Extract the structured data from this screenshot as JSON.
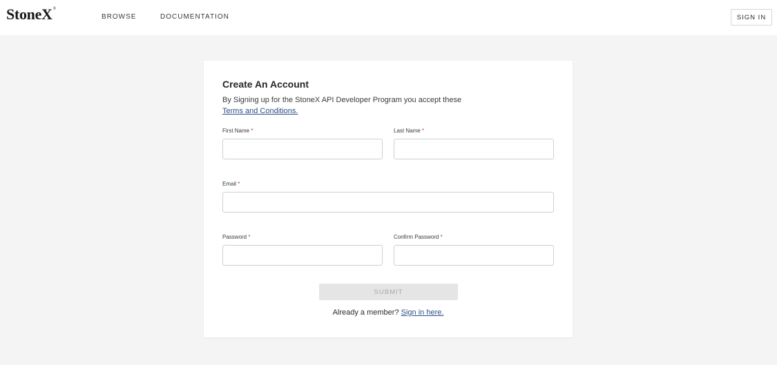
{
  "header": {
    "logo_text": "StoneX",
    "logo_mark": "®",
    "nav": [
      {
        "label": "BROWSE"
      },
      {
        "label": "DOCUMENTATION"
      }
    ],
    "sign_in_label": "SIGN IN"
  },
  "form": {
    "title": "Create An Account",
    "description": "By Signing up for the StoneX API Developer Program you accept these",
    "terms_link": "Terms and Conditions.",
    "required_mark": "*",
    "fields": {
      "first_name": {
        "label": "First Name",
        "value": ""
      },
      "last_name": {
        "label": "Last Name",
        "value": ""
      },
      "email": {
        "label": "Email",
        "value": ""
      },
      "password": {
        "label": "Password",
        "value": ""
      },
      "confirm_password": {
        "label": "Confirm Password",
        "value": ""
      }
    },
    "submit_label": "SUBMIT",
    "member_prompt": "Already a member?",
    "member_link": "Sign in here."
  },
  "colors": {
    "page_background": "#f3f4f3",
    "link": "#2b4f86",
    "required": "#c0392b",
    "submit_disabled_bg": "#e5e5e5"
  }
}
